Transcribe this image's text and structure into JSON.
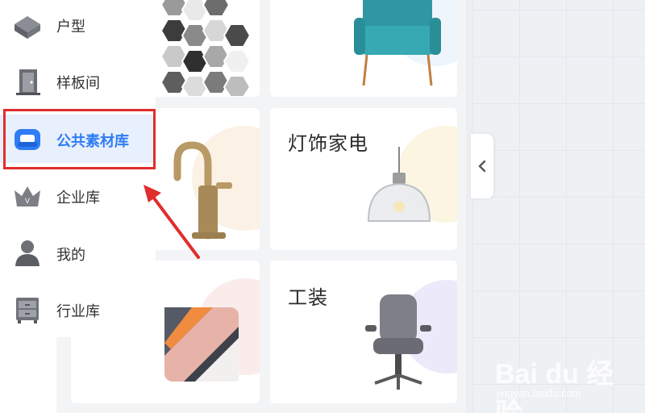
{
  "sidebar": {
    "items": [
      {
        "label": "户型",
        "icon": "house-icon",
        "active": false
      },
      {
        "label": "样板间",
        "icon": "door-icon",
        "active": false
      },
      {
        "label": "公共素材库",
        "icon": "sofa-icon",
        "active": true
      },
      {
        "label": "企业库",
        "icon": "crown-icon",
        "active": false
      },
      {
        "label": "我的",
        "icon": "user-icon",
        "active": false
      },
      {
        "label": "行业库",
        "icon": "cabinet-icon",
        "active": false
      }
    ]
  },
  "categories": [
    {
      "label": "",
      "image": "hexagon-tiles"
    },
    {
      "label": "",
      "image": "armchair"
    },
    {
      "label": "",
      "image": "faucet"
    },
    {
      "label": "灯饰家电",
      "image": "pendant-lamp"
    },
    {
      "label": "",
      "image": "pillow"
    },
    {
      "label": "工装",
      "image": "office-chair"
    }
  ],
  "watermark": {
    "main": "Bai du 经验",
    "sub": "jingyan.baidu.com"
  },
  "colors": {
    "accent": "#2f7cf6",
    "annotation": "#e02d2d",
    "active_bg": "#e8f0fd"
  }
}
